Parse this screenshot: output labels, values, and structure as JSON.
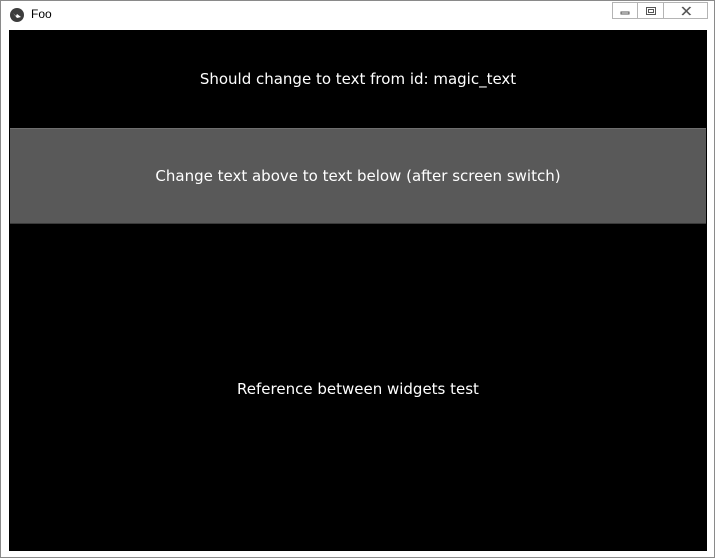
{
  "window": {
    "title": "Foo",
    "app_icon": "kivy-logo-icon",
    "controls": {
      "minimize_icon": "minimize-icon",
      "restore_icon": "restore-icon",
      "close_icon": "close-icon"
    }
  },
  "main": {
    "top_label": "Should change to text from id: magic_text",
    "button_label": "Change text above to text below (after screen switch)",
    "bottom_label": "Reference between widgets test"
  },
  "colors": {
    "background": "#000000",
    "button": "#595959",
    "text": "#ffffff"
  }
}
